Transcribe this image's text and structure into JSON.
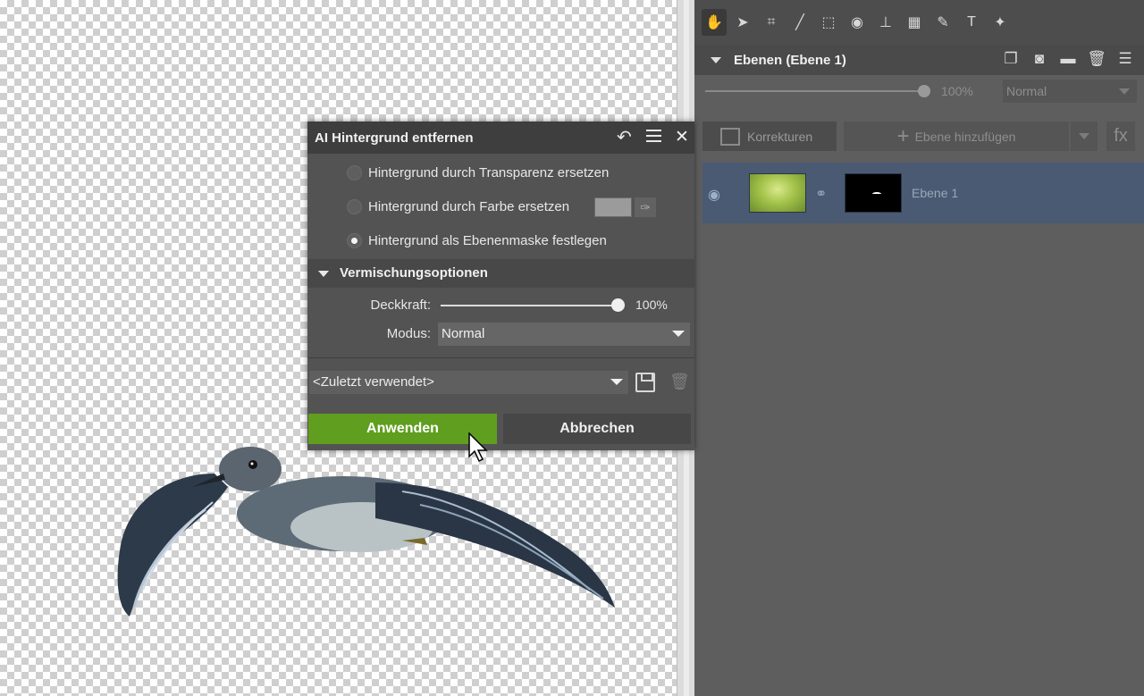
{
  "canvas": {
    "subject": "bird-flying"
  },
  "toolbar": {
    "tools": [
      "hand-icon",
      "pointer-icon",
      "crop-icon",
      "straighten-icon",
      "transform-icon",
      "eye-icon",
      "level-icon",
      "grid-icon",
      "brush-icon",
      "text-icon",
      "sparkle-icon"
    ]
  },
  "layers": {
    "title": "Ebenen (Ebene 1)",
    "opacity": "100%",
    "blend_mode": "Normal",
    "korrekturen_label": "Korrekturen",
    "add_layer_label": "Ebene hinzufügen",
    "fx_label": "fx",
    "items": [
      {
        "name": "Ebene 1"
      }
    ]
  },
  "dialog": {
    "title": "AI Hintergrund entfernen",
    "options": [
      {
        "label": "Hintergrund durch Transparenz ersetzen",
        "selected": false
      },
      {
        "label": "Hintergrund durch Farbe ersetzen",
        "selected": false
      },
      {
        "label": "Hintergrund als Ebenenmaske festlegen",
        "selected": true
      }
    ],
    "swatch_color": "#9b9b9b",
    "section_title": "Vermischungsoptionen",
    "opacity_label": "Deckkraft:",
    "opacity_value": "100%",
    "mode_label": "Modus:",
    "mode_value": "Normal",
    "preset_value": "<Zuletzt verwendet>",
    "apply_label": "Anwenden",
    "cancel_label": "Abbrechen"
  },
  "colors": {
    "apply_green": "#5f9e1f",
    "selected_layer": "#4a5a73",
    "panel_bg": "#5e5e5e"
  }
}
